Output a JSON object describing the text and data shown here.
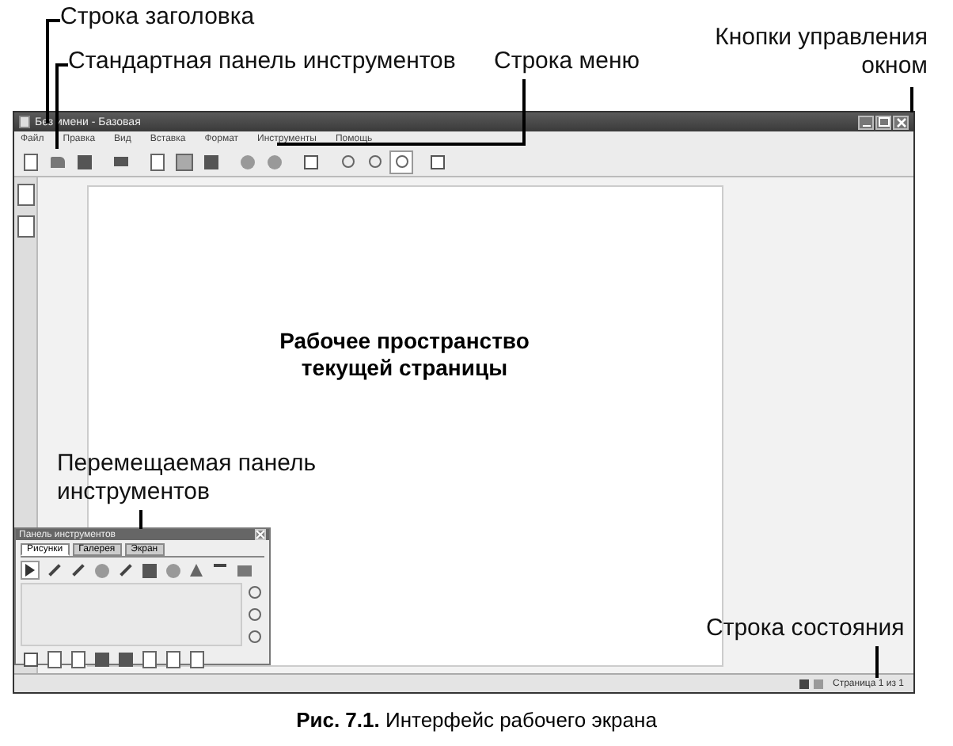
{
  "annotations": {
    "title_bar": "Строка заголовка",
    "standard_toolbar": "Стандартная панель инструментов",
    "menu_bar": "Строка меню",
    "window_controls": "Кнопки управления окном",
    "workspace": "Рабочее пространство текущей страницы",
    "floating_toolbar": "Перемещаемая панель инструментов",
    "status_bar": "Строка состояния"
  },
  "window": {
    "title": "Без имени - Базовая"
  },
  "menu": [
    "Файл",
    "Правка",
    "Вид",
    "Вставка",
    "Формат",
    "Инструменты",
    "Помощь"
  ],
  "floating_panel": {
    "title": "Панель инструментов",
    "tabs": [
      {
        "label": "Рисунки",
        "selected": true
      },
      {
        "label": "Галерея",
        "selected": false
      },
      {
        "label": "Экран",
        "selected": false
      }
    ]
  },
  "status_bar": {
    "page": "Страница 1 из 1"
  },
  "caption": "**Рис. 7.1.** Интерфейс рабочего экрана"
}
